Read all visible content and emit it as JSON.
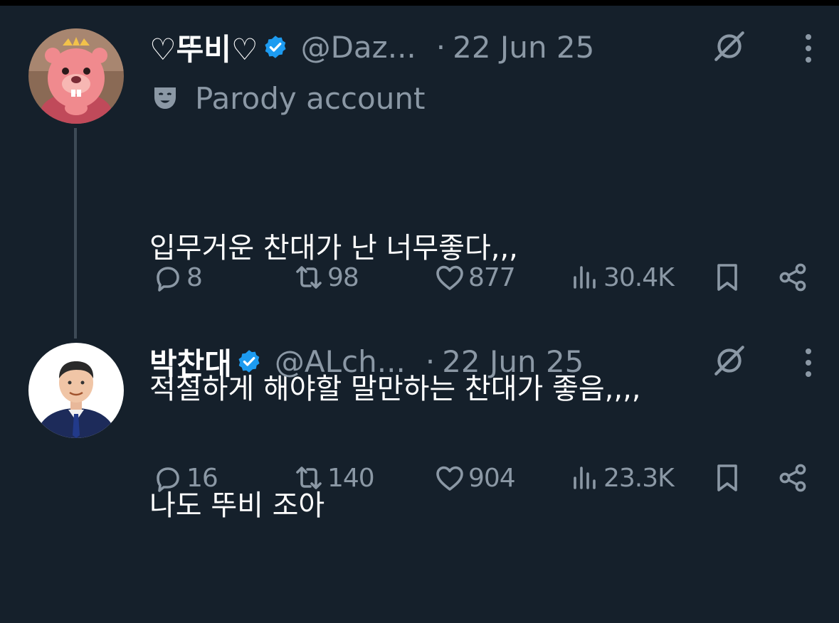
{
  "colors": {
    "background": "#15202b",
    "text_primary": "#ffffff",
    "text_secondary": "#8b98a5",
    "verified_badge": "#1d9bf0",
    "thread_line": "#3d4a56"
  },
  "tweets": [
    {
      "display_name": "♡뚜비♡",
      "verified": true,
      "handle": "@Daz...",
      "separator": "·",
      "date": "22 Jun 25",
      "label": "Parody account",
      "label_icon": "theater-mask-icon",
      "text_lines": [
        "입무거운 찬대가 난 너무좋다,,,",
        "적절하게 해야할 말만하는 찬대가 좋음,,,,"
      ],
      "replies": "8",
      "retweets": "98",
      "likes": "877",
      "views": "30.4K"
    },
    {
      "display_name": "박찬대",
      "verified": true,
      "handle": "@ALch...",
      "separator": "·",
      "date": "22 Jun 25",
      "text_lines": [
        "나도 뚜비 조아"
      ],
      "replies": "16",
      "retweets": "140",
      "likes": "904",
      "views": "23.3K"
    }
  ],
  "icons": {
    "verified": "verified-badge-icon",
    "grok": "grok-icon",
    "more": "more-icon",
    "reply": "reply-icon",
    "retweet": "retweet-icon",
    "like": "heart-icon",
    "views": "views-icon",
    "bookmark": "bookmark-icon",
    "share": "share-icon"
  }
}
